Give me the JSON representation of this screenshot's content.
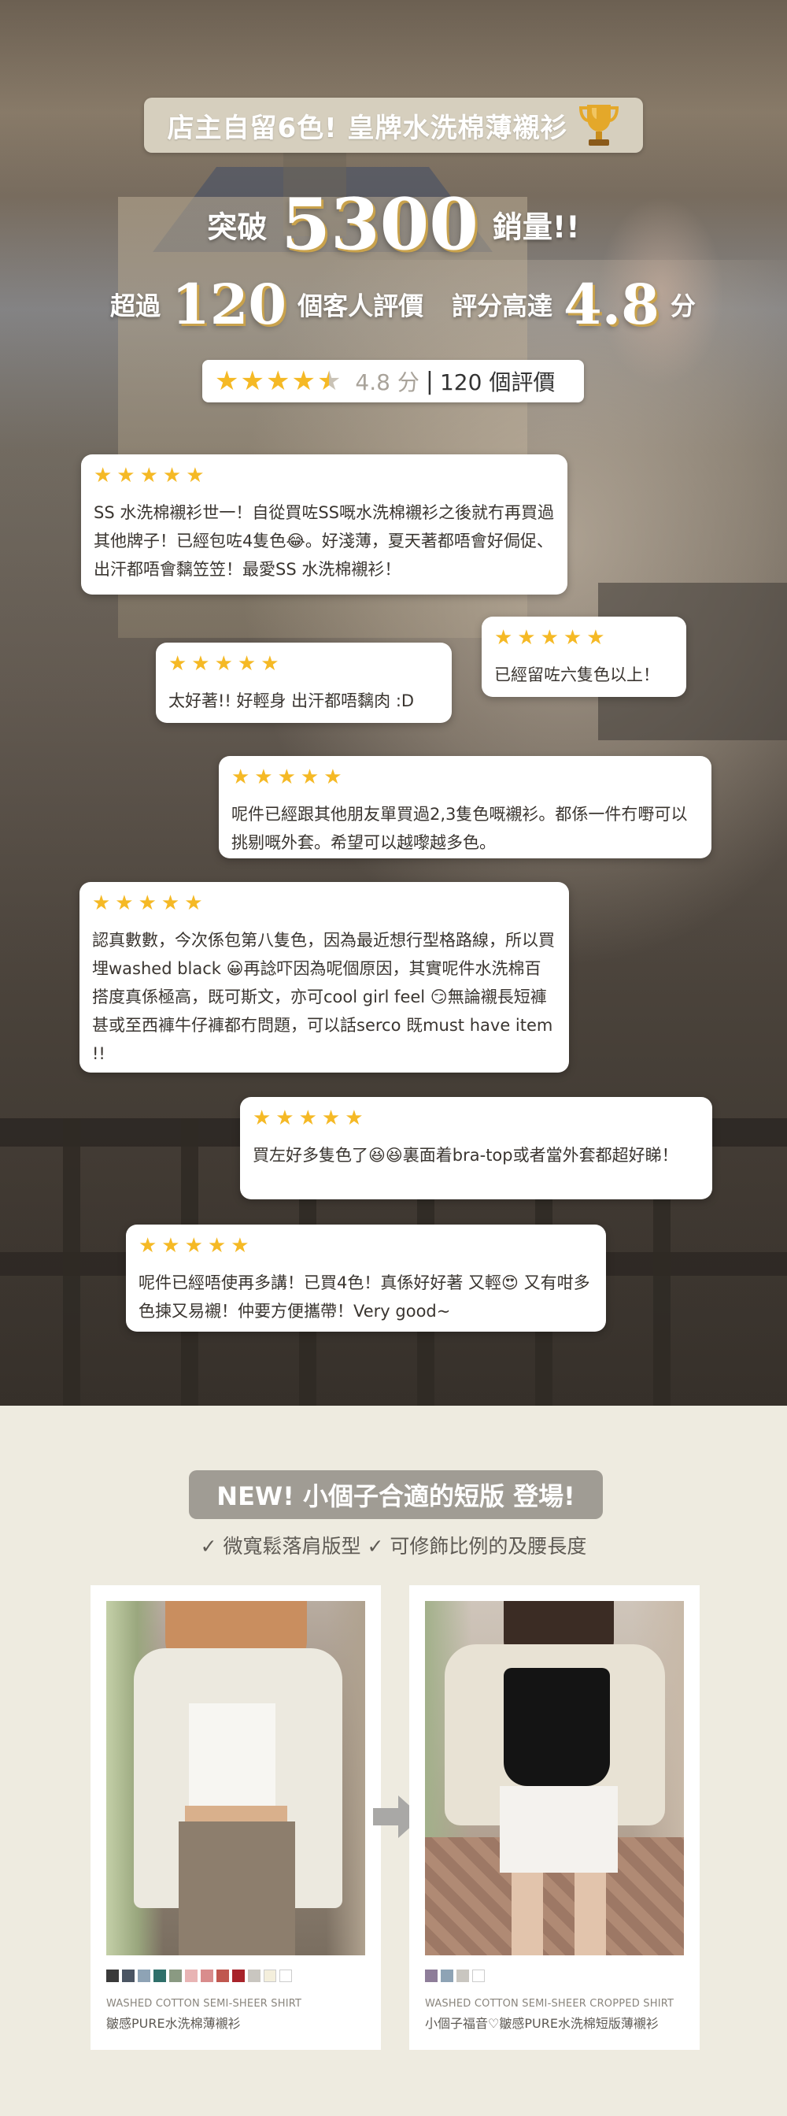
{
  "hero": {
    "title": "店主自留6色! 皇牌水洗棉薄襯衫",
    "trophy_icon": "trophy-icon",
    "sales_prefix": "突破",
    "sales_number": "5300",
    "sales_suffix": "銷量!!",
    "reviews_prefix": "超過",
    "reviews_number": "120",
    "reviews_suffix": "個客人評價",
    "score_prefix": "評分高達",
    "score_number": "4.8",
    "score_suffix": "分",
    "rating_bar": {
      "stars": 4.5,
      "score_text": "4.8 分",
      "separator": "|",
      "count_text": "120 個評價"
    }
  },
  "reviews": [
    {
      "stars": 5,
      "text": "SS 水洗棉襯衫世一！自從買咗SS嘅水洗棉襯衫之後就冇再買過其他牌子！已經包咗4隻色😂。好淺薄，夏天著都唔會好侷促、出汗都唔會黐笠笠！最愛SS 水洗棉襯衫！"
    },
    {
      "stars": 5,
      "text": "已經留咗六隻色以上！"
    },
    {
      "stars": 5,
      "text": "太好著!! 好輕身 出汗都唔黐肉 :D"
    },
    {
      "stars": 5,
      "text": "呢件已經跟其他朋友單買過2,3隻色嘅襯衫。都係一件冇嘢可以挑剔嘅外套。希望可以越嚟越多色。"
    },
    {
      "stars": 5,
      "text": "認真數數，今次係包第八隻色，因為最近想行型格路線，所以買埋washed black 😀再諗吓因為呢個原因，其實呢件水洗棉百搭度真係極高，既可斯文，亦可cool girl feel 😏無論襯長短褲甚或至西褲牛仔褲都冇問題，可以話serco 既must have item !!"
    },
    {
      "stars": 5,
      "text": "買左好多隻色了😆😆裏面着bra-top或者當外套都超好睇！"
    },
    {
      "stars": 5,
      "text": "呢件已經唔使再多講！已買4色！真係好好著 又輕😍 又有咁多色揀又易襯！仲要方便攜帶！Very good~"
    }
  ],
  "new_section": {
    "title": "NEW! 小個子合適的短版 登場!",
    "features": "✓ 微寬鬆落肩版型  ✓ 可修飾比例的及腰長度",
    "products": [
      {
        "name_en": "WASHED COTTON SEMI-SHEER SHIRT",
        "name_zh": "皺感PURE水洗棉薄襯衫",
        "swatches": [
          "#3a3a3a",
          "#4b5563",
          "#8ea3b5",
          "#2f6f6a",
          "#8a9a82",
          "#e8b4b4",
          "#d98c8c",
          "#c0574f",
          "#a8232a",
          "#c9c6c0",
          "#f4efdc",
          "#ffffff"
        ]
      },
      {
        "name_en": "WASHED COTTON SEMI-SHEER CROPPED SHIRT",
        "name_zh": "小個子福音♡皺感PURE水洗棉短版薄襯衫",
        "swatches": [
          "#8e7d99",
          "#8ea3b5",
          "#c9c6c0",
          "#ffffff"
        ]
      }
    ],
    "arrow_icon": "right-arrow-icon"
  }
}
